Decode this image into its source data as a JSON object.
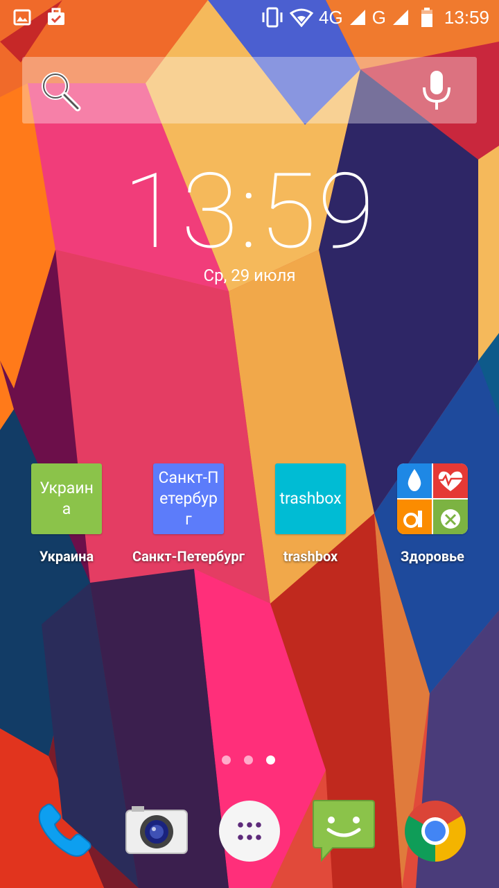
{
  "status_bar": {
    "left_icons": [
      "image-icon",
      "briefcase-check-icon"
    ],
    "network_1": "4G",
    "network_2": "G",
    "time": "13:59"
  },
  "search_bar": {
    "icons": [
      "search-icon",
      "microphone-icon"
    ]
  },
  "clock": {
    "time": "13:59",
    "date": "Ср, 29 июля"
  },
  "apps": [
    {
      "name": "ukraine",
      "tile_text": "Украина",
      "label": "Украина",
      "color": "#8bc34a"
    },
    {
      "name": "saint-petersburg",
      "tile_text": "Санкт-Петербург",
      "label": "Санкт-Петербург",
      "color": "#5c7cfa"
    },
    {
      "name": "trashbox",
      "tile_text": "trashbox",
      "label": "trashbox",
      "color": "#00bcd4"
    },
    {
      "name": "health",
      "tile_text": "",
      "label": "Здоровье",
      "color": "#ffffff"
    }
  ],
  "page_indicator": {
    "count": 3,
    "active_index": 2
  },
  "dock": [
    {
      "name": "phone",
      "icon": "phone-icon"
    },
    {
      "name": "camera",
      "icon": "camera-icon"
    },
    {
      "name": "app-drawer",
      "icon": "app-drawer-icon"
    },
    {
      "name": "messaging",
      "icon": "messaging-icon"
    },
    {
      "name": "chrome",
      "icon": "chrome-icon"
    }
  ]
}
